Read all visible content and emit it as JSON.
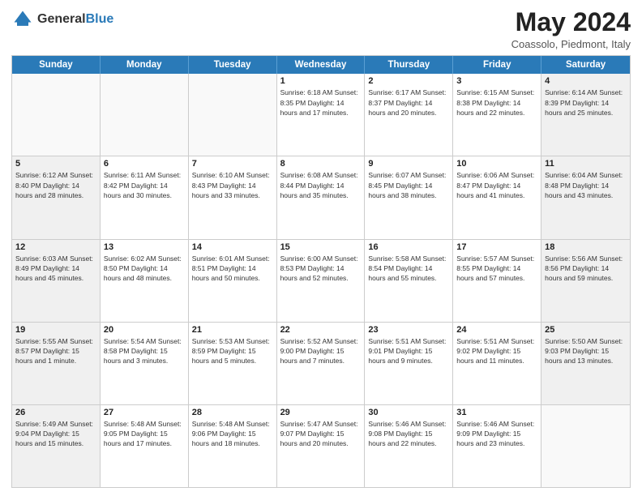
{
  "header": {
    "logo_general": "General",
    "logo_blue": "Blue",
    "month": "May 2024",
    "location": "Coassolo, Piedmont, Italy"
  },
  "weekdays": [
    "Sunday",
    "Monday",
    "Tuesday",
    "Wednesday",
    "Thursday",
    "Friday",
    "Saturday"
  ],
  "rows": [
    [
      {
        "day": "",
        "info": "",
        "empty": true
      },
      {
        "day": "",
        "info": "",
        "empty": true
      },
      {
        "day": "",
        "info": "",
        "empty": true
      },
      {
        "day": "1",
        "info": "Sunrise: 6:18 AM\nSunset: 8:35 PM\nDaylight: 14 hours\nand 17 minutes.",
        "empty": false
      },
      {
        "day": "2",
        "info": "Sunrise: 6:17 AM\nSunset: 8:37 PM\nDaylight: 14 hours\nand 20 minutes.",
        "empty": false
      },
      {
        "day": "3",
        "info": "Sunrise: 6:15 AM\nSunset: 8:38 PM\nDaylight: 14 hours\nand 22 minutes.",
        "empty": false
      },
      {
        "day": "4",
        "info": "Sunrise: 6:14 AM\nSunset: 8:39 PM\nDaylight: 14 hours\nand 25 minutes.",
        "empty": false,
        "shaded": true
      }
    ],
    [
      {
        "day": "5",
        "info": "Sunrise: 6:12 AM\nSunset: 8:40 PM\nDaylight: 14 hours\nand 28 minutes.",
        "empty": false,
        "shaded": true
      },
      {
        "day": "6",
        "info": "Sunrise: 6:11 AM\nSunset: 8:42 PM\nDaylight: 14 hours\nand 30 minutes.",
        "empty": false
      },
      {
        "day": "7",
        "info": "Sunrise: 6:10 AM\nSunset: 8:43 PM\nDaylight: 14 hours\nand 33 minutes.",
        "empty": false
      },
      {
        "day": "8",
        "info": "Sunrise: 6:08 AM\nSunset: 8:44 PM\nDaylight: 14 hours\nand 35 minutes.",
        "empty": false
      },
      {
        "day": "9",
        "info": "Sunrise: 6:07 AM\nSunset: 8:45 PM\nDaylight: 14 hours\nand 38 minutes.",
        "empty": false
      },
      {
        "day": "10",
        "info": "Sunrise: 6:06 AM\nSunset: 8:47 PM\nDaylight: 14 hours\nand 41 minutes.",
        "empty": false
      },
      {
        "day": "11",
        "info": "Sunrise: 6:04 AM\nSunset: 8:48 PM\nDaylight: 14 hours\nand 43 minutes.",
        "empty": false,
        "shaded": true
      }
    ],
    [
      {
        "day": "12",
        "info": "Sunrise: 6:03 AM\nSunset: 8:49 PM\nDaylight: 14 hours\nand 45 minutes.",
        "empty": false,
        "shaded": true
      },
      {
        "day": "13",
        "info": "Sunrise: 6:02 AM\nSunset: 8:50 PM\nDaylight: 14 hours\nand 48 minutes.",
        "empty": false
      },
      {
        "day": "14",
        "info": "Sunrise: 6:01 AM\nSunset: 8:51 PM\nDaylight: 14 hours\nand 50 minutes.",
        "empty": false
      },
      {
        "day": "15",
        "info": "Sunrise: 6:00 AM\nSunset: 8:53 PM\nDaylight: 14 hours\nand 52 minutes.",
        "empty": false
      },
      {
        "day": "16",
        "info": "Sunrise: 5:58 AM\nSunset: 8:54 PM\nDaylight: 14 hours\nand 55 minutes.",
        "empty": false
      },
      {
        "day": "17",
        "info": "Sunrise: 5:57 AM\nSunset: 8:55 PM\nDaylight: 14 hours\nand 57 minutes.",
        "empty": false
      },
      {
        "day": "18",
        "info": "Sunrise: 5:56 AM\nSunset: 8:56 PM\nDaylight: 14 hours\nand 59 minutes.",
        "empty": false,
        "shaded": true
      }
    ],
    [
      {
        "day": "19",
        "info": "Sunrise: 5:55 AM\nSunset: 8:57 PM\nDaylight: 15 hours\nand 1 minute.",
        "empty": false,
        "shaded": true
      },
      {
        "day": "20",
        "info": "Sunrise: 5:54 AM\nSunset: 8:58 PM\nDaylight: 15 hours\nand 3 minutes.",
        "empty": false
      },
      {
        "day": "21",
        "info": "Sunrise: 5:53 AM\nSunset: 8:59 PM\nDaylight: 15 hours\nand 5 minutes.",
        "empty": false
      },
      {
        "day": "22",
        "info": "Sunrise: 5:52 AM\nSunset: 9:00 PM\nDaylight: 15 hours\nand 7 minutes.",
        "empty": false
      },
      {
        "day": "23",
        "info": "Sunrise: 5:51 AM\nSunset: 9:01 PM\nDaylight: 15 hours\nand 9 minutes.",
        "empty": false
      },
      {
        "day": "24",
        "info": "Sunrise: 5:51 AM\nSunset: 9:02 PM\nDaylight: 15 hours\nand 11 minutes.",
        "empty": false
      },
      {
        "day": "25",
        "info": "Sunrise: 5:50 AM\nSunset: 9:03 PM\nDaylight: 15 hours\nand 13 minutes.",
        "empty": false,
        "shaded": true
      }
    ],
    [
      {
        "day": "26",
        "info": "Sunrise: 5:49 AM\nSunset: 9:04 PM\nDaylight: 15 hours\nand 15 minutes.",
        "empty": false,
        "shaded": true
      },
      {
        "day": "27",
        "info": "Sunrise: 5:48 AM\nSunset: 9:05 PM\nDaylight: 15 hours\nand 17 minutes.",
        "empty": false
      },
      {
        "day": "28",
        "info": "Sunrise: 5:48 AM\nSunset: 9:06 PM\nDaylight: 15 hours\nand 18 minutes.",
        "empty": false
      },
      {
        "day": "29",
        "info": "Sunrise: 5:47 AM\nSunset: 9:07 PM\nDaylight: 15 hours\nand 20 minutes.",
        "empty": false
      },
      {
        "day": "30",
        "info": "Sunrise: 5:46 AM\nSunset: 9:08 PM\nDaylight: 15 hours\nand 22 minutes.",
        "empty": false
      },
      {
        "day": "31",
        "info": "Sunrise: 5:46 AM\nSunset: 9:09 PM\nDaylight: 15 hours\nand 23 minutes.",
        "empty": false
      },
      {
        "day": "",
        "info": "",
        "empty": true
      }
    ]
  ]
}
